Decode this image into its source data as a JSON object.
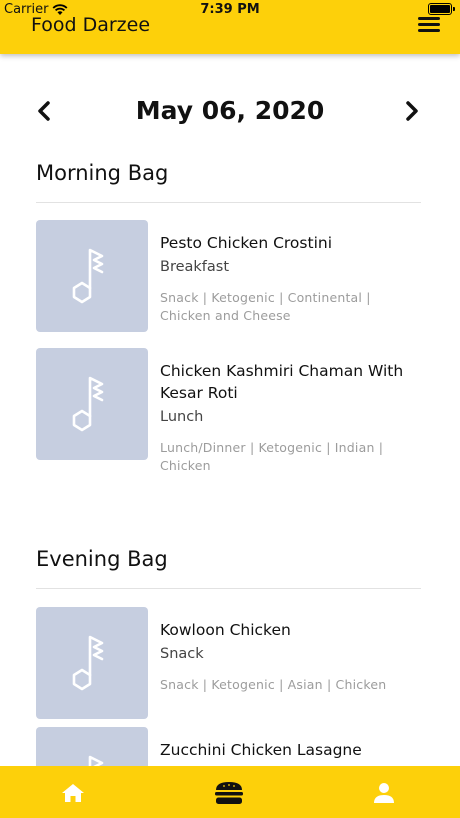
{
  "status_bar": {
    "carrier": "Carrier",
    "time": "7:39 PM"
  },
  "header": {
    "title": "Food Darzee"
  },
  "date_nav": {
    "date": "May 06, 2020"
  },
  "sections": [
    {
      "title": "Morning Bag",
      "meals": [
        {
          "name": "Pesto Chicken Crostini",
          "type": "Breakfast",
          "tags": "Snack | Ketogenic | Continental | Chicken and Cheese"
        },
        {
          "name": "Chicken Kashmiri Chaman With Kesar Roti",
          "type": "Lunch",
          "tags": "Lunch/Dinner | Ketogenic | Indian | Chicken"
        }
      ]
    },
    {
      "title": "Evening Bag",
      "meals": [
        {
          "name": "Kowloon Chicken",
          "type": "Snack",
          "tags": "Snack | Ketogenic | Asian | Chicken"
        },
        {
          "name": "Zucchini Chicken Lasagne",
          "type": "",
          "tags": ""
        }
      ]
    }
  ],
  "bottom_nav": {
    "items": [
      "home-icon",
      "burger-icon",
      "user-icon"
    ]
  },
  "colors": {
    "accent": "#FDD00A",
    "thumb": "#C6CEE0"
  }
}
